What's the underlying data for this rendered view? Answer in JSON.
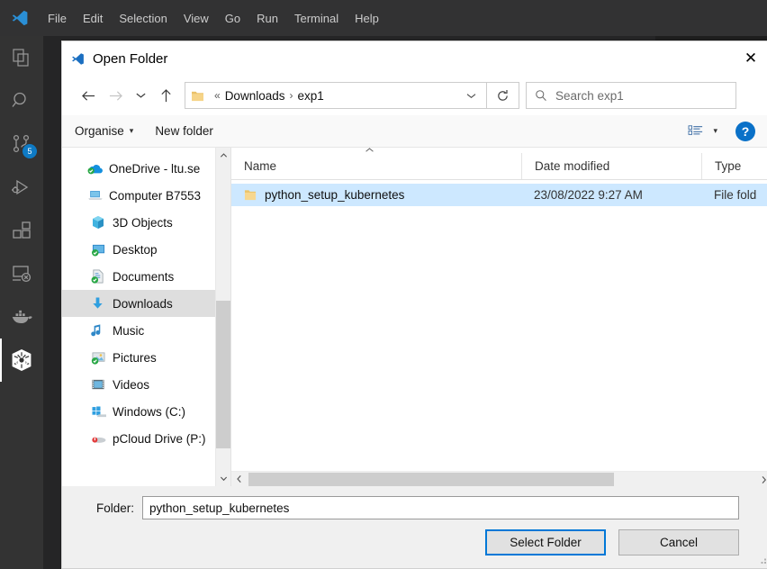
{
  "vscode": {
    "logo_icon": "vscode-logo-icon",
    "menu": [
      {
        "label": "File"
      },
      {
        "label": "Edit"
      },
      {
        "label": "Selection"
      },
      {
        "label": "View"
      },
      {
        "label": "Go"
      },
      {
        "label": "Run"
      },
      {
        "label": "Terminal"
      },
      {
        "label": "Help"
      }
    ],
    "activity_bar": [
      {
        "name": "explorer",
        "icon": "files-icon",
        "badge": null,
        "active": false
      },
      {
        "name": "search",
        "icon": "search-icon",
        "badge": null,
        "active": false
      },
      {
        "name": "source-control",
        "icon": "source-control-icon",
        "badge": "5",
        "active": false
      },
      {
        "name": "run-and-debug",
        "icon": "run-debug-icon",
        "badge": null,
        "active": false
      },
      {
        "name": "extensions",
        "icon": "extensions-icon",
        "badge": null,
        "active": false
      },
      {
        "name": "remote-explorer",
        "icon": "remote-explorer-icon",
        "badge": null,
        "active": false
      },
      {
        "name": "docker",
        "icon": "docker-whale-icon",
        "badge": null,
        "active": false
      },
      {
        "name": "kubernetes",
        "icon": "kubernetes-helm-icon",
        "badge": null,
        "active": true
      }
    ]
  },
  "dialog": {
    "title": "Open Folder",
    "title_icon": "vscode-logo-icon",
    "close_label": "✕",
    "nav": {
      "back_icon": "arrow-left-icon",
      "forward_icon": "arrow-right-icon",
      "recent_icon": "chevron-down-icon",
      "up_icon": "arrow-up-icon",
      "address_folder_icon": "folder-icon",
      "address_prefix": "«",
      "address_segments": [
        "Downloads",
        "exp1"
      ],
      "address_separator": "›",
      "address_dropdown_icon": "chevron-down-icon",
      "refresh_icon": "refresh-icon",
      "search_icon": "search-icon",
      "search_placeholder": "Search exp1",
      "search_value": ""
    },
    "toolbar": {
      "organise_label": "Organise",
      "organise_caret": "▾",
      "new_folder_label": "New folder",
      "view_icon": "view-layout-icon",
      "view_caret": "▾",
      "help_icon": "help-icon",
      "help_label": "?"
    },
    "tree": {
      "items": [
        {
          "label": "OneDrive - ltu.se",
          "icon": "onedrive-icon",
          "selected": false,
          "indent": false
        },
        {
          "label": "Computer B7553",
          "icon": "computer-icon",
          "selected": false,
          "indent": false
        },
        {
          "label": "3D Objects",
          "icon": "3d-objects-icon",
          "selected": false,
          "indent": true
        },
        {
          "label": "Desktop",
          "icon": "desktop-icon",
          "selected": false,
          "indent": true
        },
        {
          "label": "Documents",
          "icon": "documents-icon",
          "selected": false,
          "indent": true
        },
        {
          "label": "Downloads",
          "icon": "downloads-icon",
          "selected": true,
          "indent": true
        },
        {
          "label": "Music",
          "icon": "music-icon",
          "selected": false,
          "indent": true
        },
        {
          "label": "Pictures",
          "icon": "pictures-icon",
          "selected": false,
          "indent": true
        },
        {
          "label": "Videos",
          "icon": "videos-icon",
          "selected": false,
          "indent": true
        },
        {
          "label": "Windows (C:)",
          "icon": "windows-drive-icon",
          "selected": false,
          "indent": true
        },
        {
          "label": "pCloud Drive (P:)",
          "icon": "pcloud-drive-icon",
          "selected": false,
          "indent": true
        }
      ],
      "scroll_up_icon": "chevron-up-icon",
      "scroll_down_icon": "chevron-down-icon"
    },
    "file_list": {
      "sort_indicator_icon": "chevron-up-icon",
      "columns": [
        {
          "label": "Name"
        },
        {
          "label": "Date modified"
        },
        {
          "label": "Type"
        }
      ],
      "rows": [
        {
          "icon": "folder-icon",
          "name": "python_setup_kubernetes",
          "date_modified": "23/08/2022 9:27 AM",
          "type": "File fold",
          "selected": true
        }
      ],
      "scroll_left_icon": "chevron-left-icon",
      "scroll_right_icon": "chevron-right-icon"
    },
    "footer": {
      "folder_label": "Folder:",
      "folder_value": "python_setup_kubernetes",
      "folder_placeholder": "",
      "select_label": "Select Folder",
      "cancel_label": "Cancel",
      "resize_grip_icon": "resize-grip-icon"
    }
  },
  "colors": {
    "accent": "#0078d7",
    "selection": "#cde8ff",
    "tree_selection": "#dedede",
    "badge": "#0e7ac4",
    "help_blue": "#0a71c8",
    "vscode_titlebar": "#323233",
    "vscode_activitybar": "#333333",
    "vscode_editor": "#1e1e1e"
  }
}
